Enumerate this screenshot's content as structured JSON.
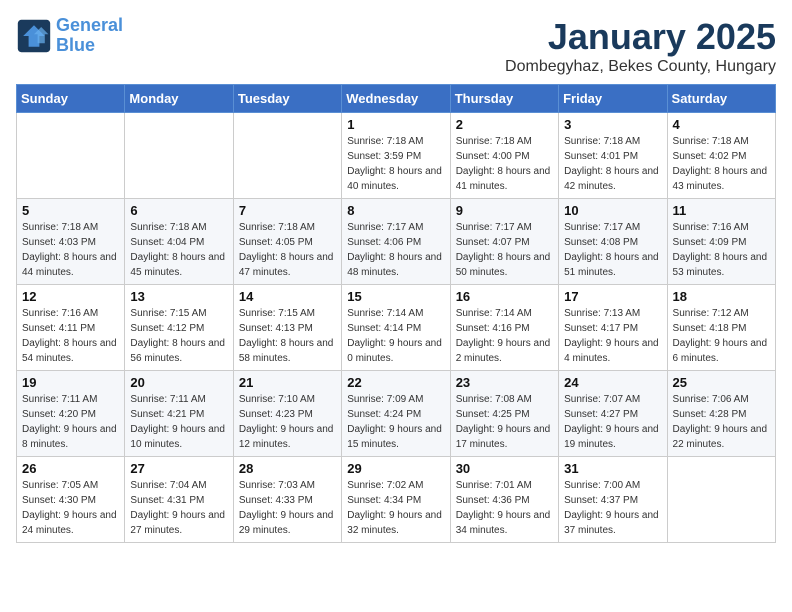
{
  "logo": {
    "line1": "General",
    "line2": "Blue"
  },
  "title": "January 2025",
  "location": "Dombegyhaz, Bekes County, Hungary",
  "weekdays": [
    "Sunday",
    "Monday",
    "Tuesday",
    "Wednesday",
    "Thursday",
    "Friday",
    "Saturday"
  ],
  "weeks": [
    [
      {
        "day": "",
        "sunrise": "",
        "sunset": "",
        "daylight": ""
      },
      {
        "day": "",
        "sunrise": "",
        "sunset": "",
        "daylight": ""
      },
      {
        "day": "",
        "sunrise": "",
        "sunset": "",
        "daylight": ""
      },
      {
        "day": "1",
        "sunrise": "Sunrise: 7:18 AM",
        "sunset": "Sunset: 3:59 PM",
        "daylight": "Daylight: 8 hours and 40 minutes."
      },
      {
        "day": "2",
        "sunrise": "Sunrise: 7:18 AM",
        "sunset": "Sunset: 4:00 PM",
        "daylight": "Daylight: 8 hours and 41 minutes."
      },
      {
        "day": "3",
        "sunrise": "Sunrise: 7:18 AM",
        "sunset": "Sunset: 4:01 PM",
        "daylight": "Daylight: 8 hours and 42 minutes."
      },
      {
        "day": "4",
        "sunrise": "Sunrise: 7:18 AM",
        "sunset": "Sunset: 4:02 PM",
        "daylight": "Daylight: 8 hours and 43 minutes."
      }
    ],
    [
      {
        "day": "5",
        "sunrise": "Sunrise: 7:18 AM",
        "sunset": "Sunset: 4:03 PM",
        "daylight": "Daylight: 8 hours and 44 minutes."
      },
      {
        "day": "6",
        "sunrise": "Sunrise: 7:18 AM",
        "sunset": "Sunset: 4:04 PM",
        "daylight": "Daylight: 8 hours and 45 minutes."
      },
      {
        "day": "7",
        "sunrise": "Sunrise: 7:18 AM",
        "sunset": "Sunset: 4:05 PM",
        "daylight": "Daylight: 8 hours and 47 minutes."
      },
      {
        "day": "8",
        "sunrise": "Sunrise: 7:17 AM",
        "sunset": "Sunset: 4:06 PM",
        "daylight": "Daylight: 8 hours and 48 minutes."
      },
      {
        "day": "9",
        "sunrise": "Sunrise: 7:17 AM",
        "sunset": "Sunset: 4:07 PM",
        "daylight": "Daylight: 8 hours and 50 minutes."
      },
      {
        "day": "10",
        "sunrise": "Sunrise: 7:17 AM",
        "sunset": "Sunset: 4:08 PM",
        "daylight": "Daylight: 8 hours and 51 minutes."
      },
      {
        "day": "11",
        "sunrise": "Sunrise: 7:16 AM",
        "sunset": "Sunset: 4:09 PM",
        "daylight": "Daylight: 8 hours and 53 minutes."
      }
    ],
    [
      {
        "day": "12",
        "sunrise": "Sunrise: 7:16 AM",
        "sunset": "Sunset: 4:11 PM",
        "daylight": "Daylight: 8 hours and 54 minutes."
      },
      {
        "day": "13",
        "sunrise": "Sunrise: 7:15 AM",
        "sunset": "Sunset: 4:12 PM",
        "daylight": "Daylight: 8 hours and 56 minutes."
      },
      {
        "day": "14",
        "sunrise": "Sunrise: 7:15 AM",
        "sunset": "Sunset: 4:13 PM",
        "daylight": "Daylight: 8 hours and 58 minutes."
      },
      {
        "day": "15",
        "sunrise": "Sunrise: 7:14 AM",
        "sunset": "Sunset: 4:14 PM",
        "daylight": "Daylight: 9 hours and 0 minutes."
      },
      {
        "day": "16",
        "sunrise": "Sunrise: 7:14 AM",
        "sunset": "Sunset: 4:16 PM",
        "daylight": "Daylight: 9 hours and 2 minutes."
      },
      {
        "day": "17",
        "sunrise": "Sunrise: 7:13 AM",
        "sunset": "Sunset: 4:17 PM",
        "daylight": "Daylight: 9 hours and 4 minutes."
      },
      {
        "day": "18",
        "sunrise": "Sunrise: 7:12 AM",
        "sunset": "Sunset: 4:18 PM",
        "daylight": "Daylight: 9 hours and 6 minutes."
      }
    ],
    [
      {
        "day": "19",
        "sunrise": "Sunrise: 7:11 AM",
        "sunset": "Sunset: 4:20 PM",
        "daylight": "Daylight: 9 hours and 8 minutes."
      },
      {
        "day": "20",
        "sunrise": "Sunrise: 7:11 AM",
        "sunset": "Sunset: 4:21 PM",
        "daylight": "Daylight: 9 hours and 10 minutes."
      },
      {
        "day": "21",
        "sunrise": "Sunrise: 7:10 AM",
        "sunset": "Sunset: 4:23 PM",
        "daylight": "Daylight: 9 hours and 12 minutes."
      },
      {
        "day": "22",
        "sunrise": "Sunrise: 7:09 AM",
        "sunset": "Sunset: 4:24 PM",
        "daylight": "Daylight: 9 hours and 15 minutes."
      },
      {
        "day": "23",
        "sunrise": "Sunrise: 7:08 AM",
        "sunset": "Sunset: 4:25 PM",
        "daylight": "Daylight: 9 hours and 17 minutes."
      },
      {
        "day": "24",
        "sunrise": "Sunrise: 7:07 AM",
        "sunset": "Sunset: 4:27 PM",
        "daylight": "Daylight: 9 hours and 19 minutes."
      },
      {
        "day": "25",
        "sunrise": "Sunrise: 7:06 AM",
        "sunset": "Sunset: 4:28 PM",
        "daylight": "Daylight: 9 hours and 22 minutes."
      }
    ],
    [
      {
        "day": "26",
        "sunrise": "Sunrise: 7:05 AM",
        "sunset": "Sunset: 4:30 PM",
        "daylight": "Daylight: 9 hours and 24 minutes."
      },
      {
        "day": "27",
        "sunrise": "Sunrise: 7:04 AM",
        "sunset": "Sunset: 4:31 PM",
        "daylight": "Daylight: 9 hours and 27 minutes."
      },
      {
        "day": "28",
        "sunrise": "Sunrise: 7:03 AM",
        "sunset": "Sunset: 4:33 PM",
        "daylight": "Daylight: 9 hours and 29 minutes."
      },
      {
        "day": "29",
        "sunrise": "Sunrise: 7:02 AM",
        "sunset": "Sunset: 4:34 PM",
        "daylight": "Daylight: 9 hours and 32 minutes."
      },
      {
        "day": "30",
        "sunrise": "Sunrise: 7:01 AM",
        "sunset": "Sunset: 4:36 PM",
        "daylight": "Daylight: 9 hours and 34 minutes."
      },
      {
        "day": "31",
        "sunrise": "Sunrise: 7:00 AM",
        "sunset": "Sunset: 4:37 PM",
        "daylight": "Daylight: 9 hours and 37 minutes."
      },
      {
        "day": "",
        "sunrise": "",
        "sunset": "",
        "daylight": ""
      }
    ]
  ]
}
